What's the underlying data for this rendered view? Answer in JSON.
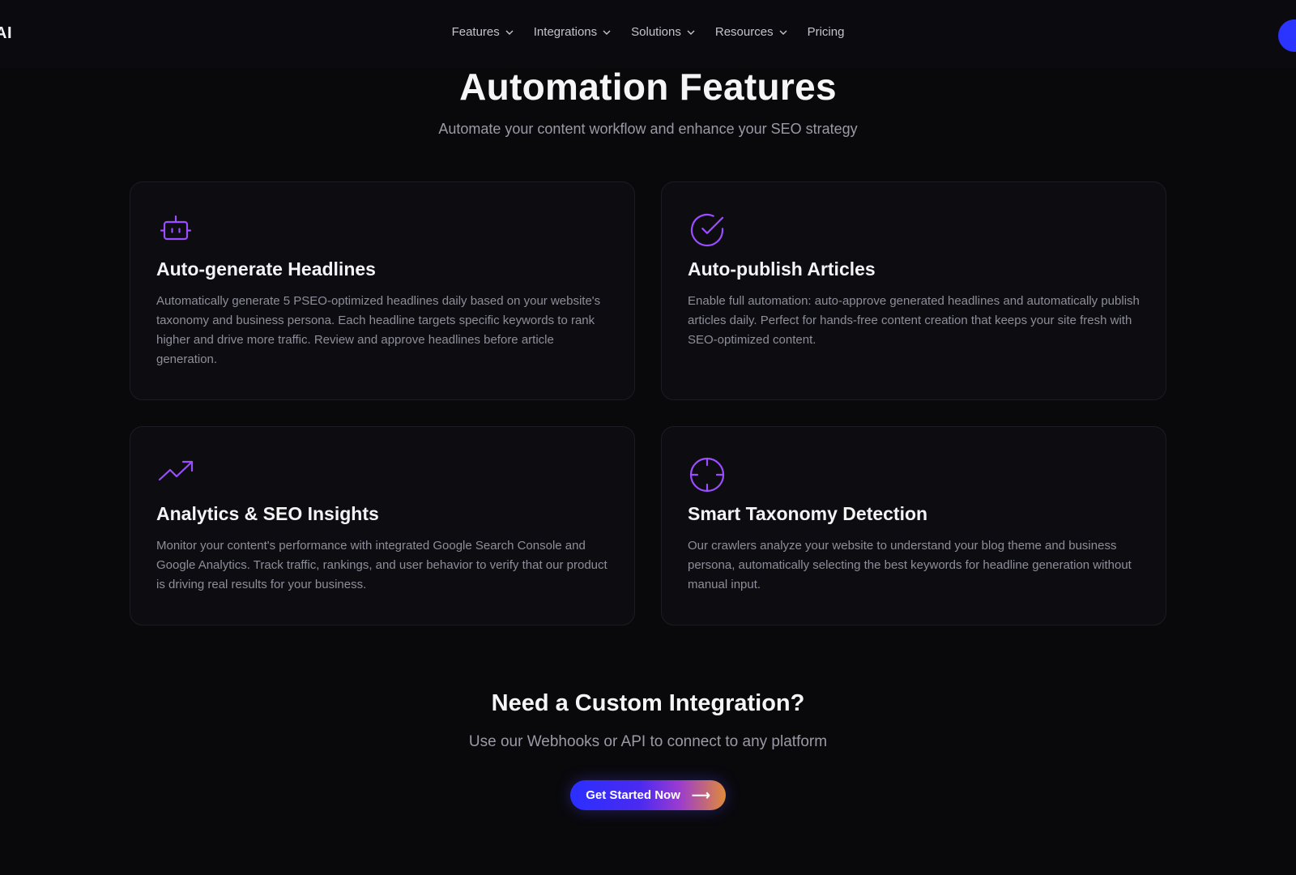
{
  "nav": {
    "brand": "AI",
    "items": [
      {
        "label": "Features",
        "has_dropdown": true
      },
      {
        "label": "Integrations",
        "has_dropdown": true
      },
      {
        "label": "Solutions",
        "has_dropdown": true
      },
      {
        "label": "Resources",
        "has_dropdown": true
      },
      {
        "label": "Pricing",
        "has_dropdown": false
      }
    ]
  },
  "section": {
    "title": "Automation Features",
    "subtitle": "Automate your content workflow and enhance your SEO strategy"
  },
  "features": [
    {
      "icon": "robot-icon",
      "title": "Auto-generate Headlines",
      "description": "Automatically generate 5 PSEO-optimized headlines daily based on your website's taxonomy and business persona. Each headline targets specific keywords to rank higher and drive more traffic. Review and approve headlines before article generation."
    },
    {
      "icon": "check-circle-icon",
      "title": "Auto-publish Articles",
      "description": "Enable full automation: auto-approve generated headlines and automatically publish articles daily. Perfect for hands-free content creation that keeps your site fresh with SEO-optimized content."
    },
    {
      "icon": "trending-up-icon",
      "title": "Analytics & SEO Insights",
      "description": "Monitor your content's performance with integrated Google Search Console and Google Analytics. Track traffic, rankings, and user behavior to verify that our product is driving real results for your business."
    },
    {
      "icon": "crosshair-icon",
      "title": "Smart Taxonomy Detection",
      "description": "Our crawlers analyze your website to understand your blog theme and business persona, automatically selecting the best keywords for headline generation without manual input."
    }
  ],
  "cta": {
    "title": "Need a Custom Integration?",
    "subtitle": "Use our Webhooks or API to connect to any platform",
    "button_label": "Get Started Now",
    "button_arrow": "⟶"
  },
  "colors": {
    "accent": "#9b4dff",
    "background": "#09090c",
    "card_bg": "#0c0c11",
    "brand_blue": "#2b33ff"
  }
}
